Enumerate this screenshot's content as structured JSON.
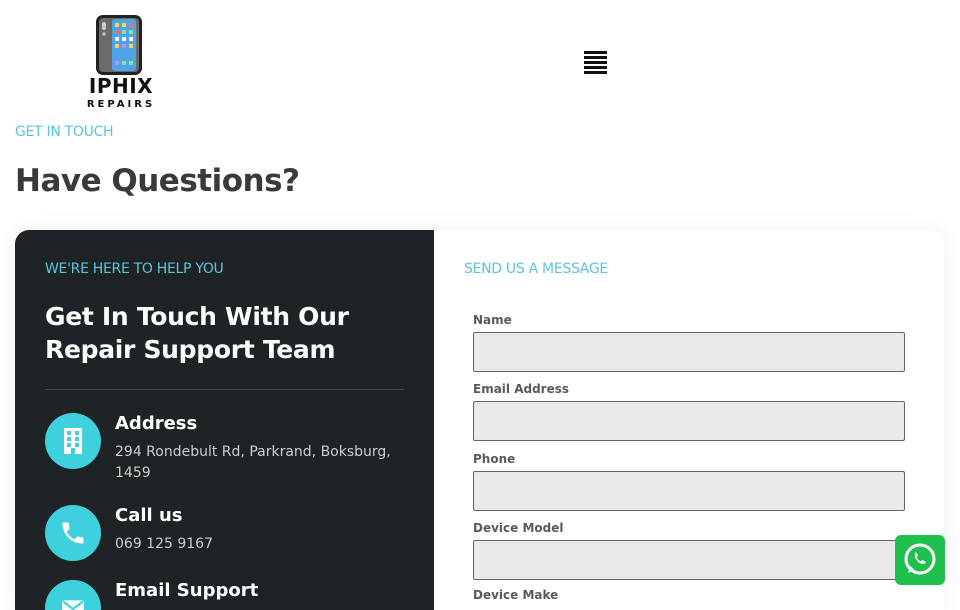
{
  "logo": {
    "brand": "IPHIX",
    "sub": "REPAIRS"
  },
  "header": {
    "menu_icon": "hamburger-menu-icon"
  },
  "intro": {
    "eyebrow": "GET IN TOUCH",
    "title": "Have Questions?"
  },
  "contact_panel": {
    "eyebrow": "WE'RE HERE TO HELP YOU",
    "heading": "Get In Touch With Our Repair Support Team",
    "items": [
      {
        "icon": "building-icon",
        "label": "Address",
        "value": "294 Rondebult Rd, Parkrand, Boksburg, 1459"
      },
      {
        "icon": "phone-icon",
        "label": "Call us",
        "value": "069 125 9167"
      },
      {
        "icon": "email-icon",
        "label": "Email Support",
        "value": ""
      }
    ]
  },
  "form": {
    "eyebrow": "SEND US A MESSAGE",
    "fields": [
      {
        "label": "Name",
        "value": ""
      },
      {
        "label": "Email Address",
        "value": ""
      },
      {
        "label": "Phone",
        "value": ""
      },
      {
        "label": "Device Model",
        "value": ""
      },
      {
        "label": "Device Make",
        "value": ""
      }
    ]
  },
  "colors": {
    "accent": "#5bc4dc",
    "icon_circle": "#3fd0de",
    "dark_panel": "#1e2425",
    "whatsapp": "#1fc04d"
  },
  "whatsapp": {
    "icon": "whatsapp-icon"
  }
}
